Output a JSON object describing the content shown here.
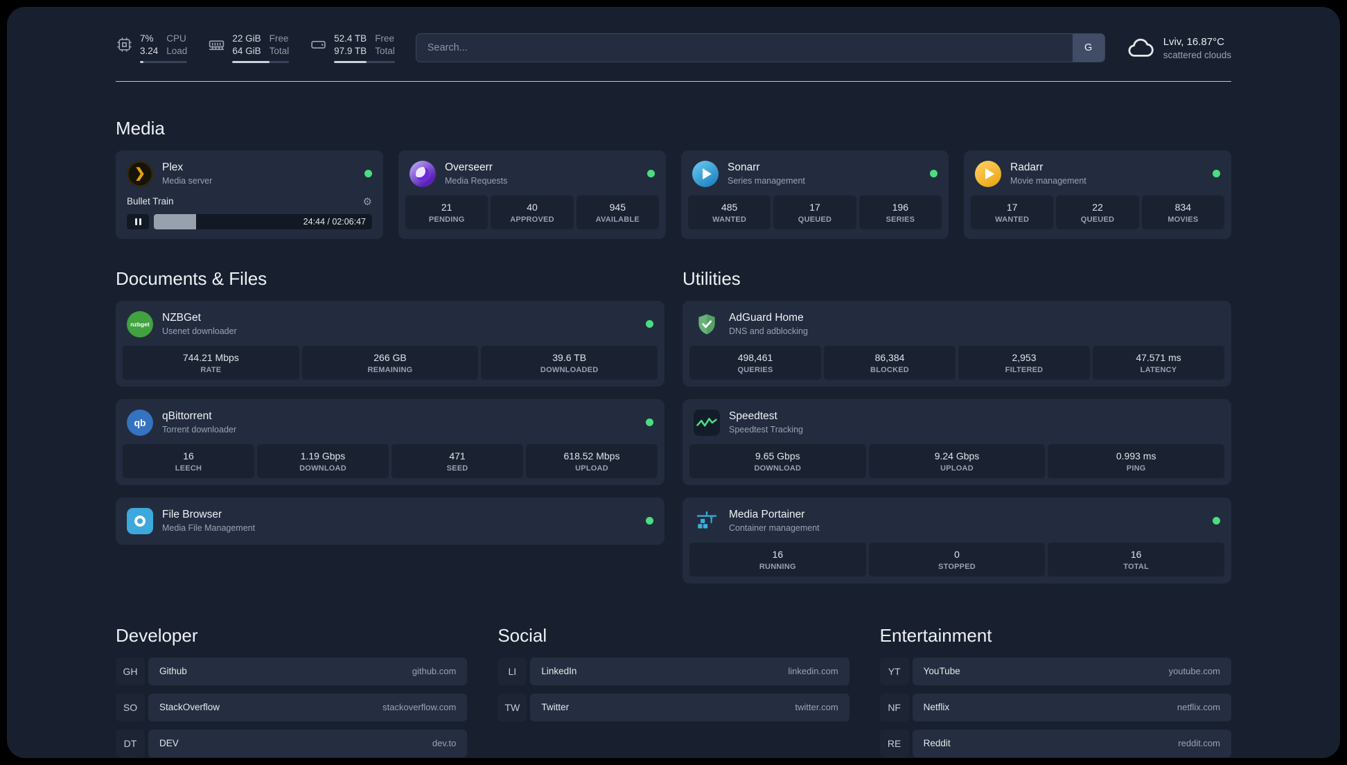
{
  "topbar": {
    "resources": [
      {
        "icon": "cpu-icon",
        "values": [
          "7%",
          "3.24"
        ],
        "labels": [
          "CPU",
          "Load"
        ],
        "progress_percent": 7
      },
      {
        "icon": "memory-icon",
        "values": [
          "22 GiB",
          "64 GiB"
        ],
        "labels": [
          "Free",
          "Total"
        ],
        "progress_percent": 66
      },
      {
        "icon": "disk-icon",
        "values": [
          "52.4 TB",
          "97.9 TB"
        ],
        "labels": [
          "Free",
          "Total"
        ],
        "progress_percent": 53
      }
    ],
    "search": {
      "placeholder": "Search...",
      "provider_button": "G"
    },
    "weather": {
      "icon": "cloud-icon",
      "location": "Lviv, 16.87°C",
      "condition": "scattered clouds"
    }
  },
  "media": {
    "title": "Media",
    "cards": [
      {
        "name": "Plex",
        "description": "Media server",
        "online": true,
        "player": {
          "title": "Bullet Train",
          "time": "24:44 / 02:06:47",
          "progress_percent": 19.5
        }
      },
      {
        "name": "Overseerr",
        "description": "Media Requests",
        "online": true,
        "stats": [
          {
            "value": "21",
            "label": "PENDING"
          },
          {
            "value": "40",
            "label": "APPROVED"
          },
          {
            "value": "945",
            "label": "AVAILABLE"
          }
        ]
      },
      {
        "name": "Sonarr",
        "description": "Series management",
        "online": true,
        "stats": [
          {
            "value": "485",
            "label": "WANTED"
          },
          {
            "value": "17",
            "label": "QUEUED"
          },
          {
            "value": "196",
            "label": "SERIES"
          }
        ]
      },
      {
        "name": "Radarr",
        "description": "Movie management",
        "online": true,
        "stats": [
          {
            "value": "17",
            "label": "WANTED"
          },
          {
            "value": "22",
            "label": "QUEUED"
          },
          {
            "value": "834",
            "label": "MOVIES"
          }
        ]
      }
    ]
  },
  "documents": {
    "title": "Documents & Files",
    "cards": [
      {
        "name": "NZBGet",
        "description": "Usenet downloader",
        "online": true,
        "stats": [
          {
            "value": "744.21 Mbps",
            "label": "RATE"
          },
          {
            "value": "266 GB",
            "label": "REMAINING"
          },
          {
            "value": "39.6 TB",
            "label": "DOWNLOADED"
          }
        ]
      },
      {
        "name": "qBittorrent",
        "description": "Torrent downloader",
        "online": true,
        "stats": [
          {
            "value": "16",
            "label": "LEECH"
          },
          {
            "value": "1.19 Gbps",
            "label": "DOWNLOAD"
          },
          {
            "value": "471",
            "label": "SEED"
          },
          {
            "value": "618.52 Mbps",
            "label": "UPLOAD"
          }
        ]
      },
      {
        "name": "File Browser",
        "description": "Media File Management",
        "online": true
      }
    ]
  },
  "utilities": {
    "title": "Utilities",
    "cards": [
      {
        "name": "AdGuard Home",
        "description": "DNS and adblocking",
        "stats": [
          {
            "value": "498,461",
            "label": "QUERIES"
          },
          {
            "value": "86,384",
            "label": "BLOCKED"
          },
          {
            "value": "2,953",
            "label": "FILTERED"
          },
          {
            "value": "47.571 ms",
            "label": "LATENCY"
          }
        ]
      },
      {
        "name": "Speedtest",
        "description": "Speedtest Tracking",
        "stats": [
          {
            "value": "9.65 Gbps",
            "label": "DOWNLOAD"
          },
          {
            "value": "9.24 Gbps",
            "label": "UPLOAD"
          },
          {
            "value": "0.993 ms",
            "label": "PING"
          }
        ]
      },
      {
        "name": "Media Portainer",
        "description": "Container management",
        "online": true,
        "stats": [
          {
            "value": "16",
            "label": "RUNNING"
          },
          {
            "value": "0",
            "label": "STOPPED"
          },
          {
            "value": "16",
            "label": "TOTAL"
          }
        ]
      }
    ]
  },
  "bookmarks": {
    "developer": {
      "title": "Developer",
      "items": [
        {
          "abbr": "GH",
          "name": "Github",
          "url": "github.com"
        },
        {
          "abbr": "SO",
          "name": "StackOverflow",
          "url": "stackoverflow.com"
        },
        {
          "abbr": "DT",
          "name": "DEV",
          "url": "dev.to"
        }
      ]
    },
    "social": {
      "title": "Social",
      "items": [
        {
          "abbr": "LI",
          "name": "LinkedIn",
          "url": "linkedin.com"
        },
        {
          "abbr": "TW",
          "name": "Twitter",
          "url": "twitter.com"
        }
      ]
    },
    "entertainment": {
      "title": "Entertainment",
      "items": [
        {
          "abbr": "YT",
          "name": "YouTube",
          "url": "youtube.com"
        },
        {
          "abbr": "NF",
          "name": "Netflix",
          "url": "netflix.com"
        },
        {
          "abbr": "RE",
          "name": "Reddit",
          "url": "reddit.com"
        }
      ]
    }
  },
  "colors": {
    "background": "#18202f",
    "card_background": "#232c3e",
    "stat_background": "#1a2231",
    "status_online": "#4ade80",
    "accent_plex": "#e5a00d",
    "accent_speedtest_line": "#4ade80"
  }
}
